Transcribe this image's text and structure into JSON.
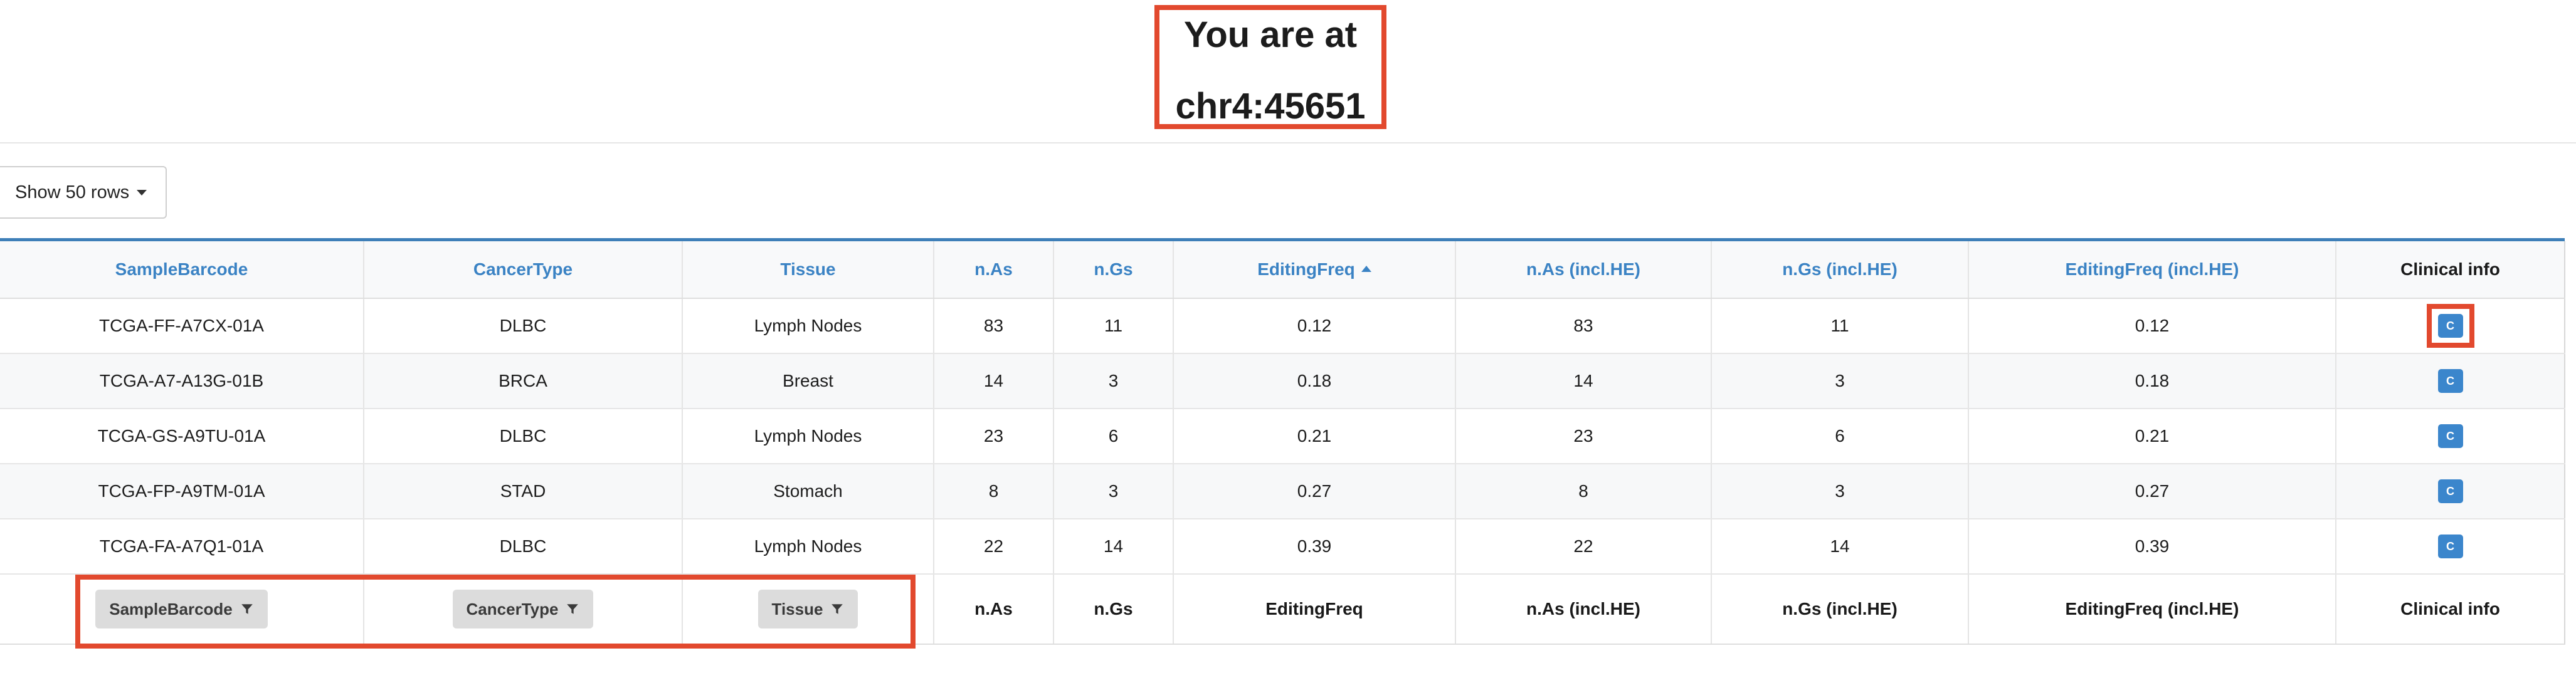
{
  "location": {
    "line1": "You are at",
    "line2": "chr4:45651"
  },
  "rows_select": {
    "label": "Show 50 rows"
  },
  "table": {
    "headers": [
      "SampleBarcode",
      "CancerType",
      "Tissue",
      "n.As",
      "n.Gs",
      "EditingFreq",
      "n.As  (incl.HE)",
      "n.Gs  (incl.HE)",
      "EditingFreq  (incl.HE)",
      "Clinical info"
    ],
    "sorted_column": "EditingFreq",
    "sort_direction": "ascending",
    "rows": [
      [
        "TCGA-FF-A7CX-01A",
        "DLBC",
        "Lymph Nodes",
        "83",
        "11",
        "0.12",
        "83",
        "11",
        "0.12"
      ],
      [
        "TCGA-A7-A13G-01B",
        "BRCA",
        "Breast",
        "14",
        "3",
        "0.18",
        "14",
        "3",
        "0.18"
      ],
      [
        "TCGA-GS-A9TU-01A",
        "DLBC",
        "Lymph Nodes",
        "23",
        "6",
        "0.21",
        "23",
        "6",
        "0.21"
      ],
      [
        "TCGA-FP-A9TM-01A",
        "STAD",
        "Stomach",
        "8",
        "3",
        "0.27",
        "8",
        "3",
        "0.27"
      ],
      [
        "TCGA-FA-A7Q1-01A",
        "DLBC",
        "Lymph Nodes",
        "22",
        "14",
        "0.39",
        "22",
        "14",
        "0.39"
      ]
    ],
    "clinical_button_label": "C",
    "footer": {
      "filters": [
        "SampleBarcode",
        "CancerType",
        "Tissue"
      ],
      "labels": [
        "n.As",
        "n.Gs",
        "EditingFreq",
        "n.As  (incl.HE)",
        "n.Gs  (incl.HE)",
        "EditingFreq  (incl.HE)",
        "Clinical info"
      ]
    }
  },
  "colors": {
    "highlight": "#e2492e",
    "header_link": "#3b83c4",
    "clinical_button": "#3b86cc",
    "table_top_border": "#3e7fb8"
  },
  "icons": {
    "filter": "funnel-icon",
    "dropdown": "caret-down-icon",
    "sort": "sort-ascending-icon"
  }
}
